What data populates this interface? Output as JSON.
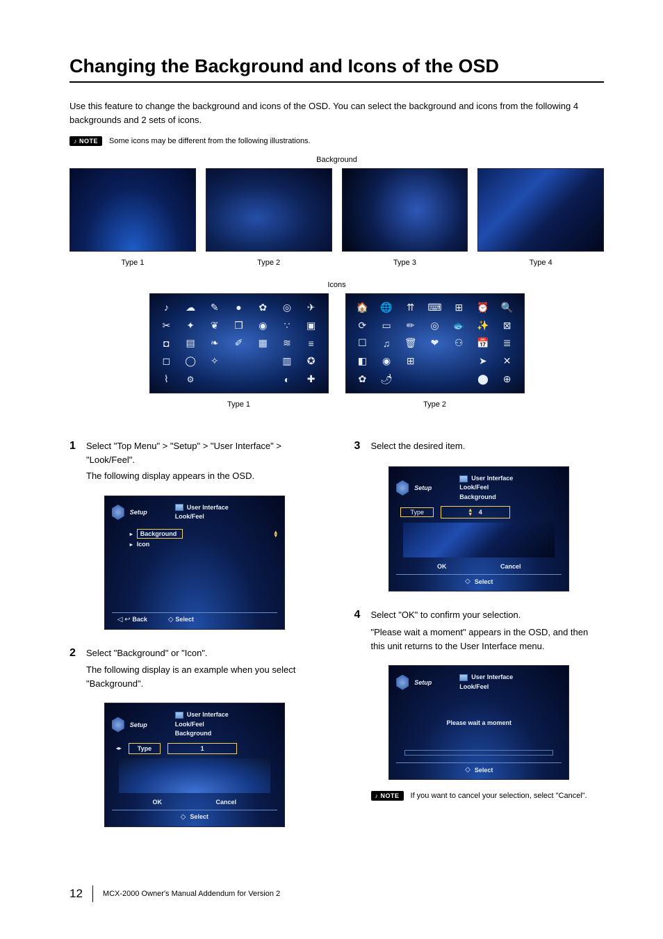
{
  "title": "Changing the Background and Icons of the OSD",
  "intro": "Use this feature to change the background and icons of the OSD. You can select the background and icons from the following 4 backgrounds and 2 sets of icons.",
  "note1": {
    "label": "NOTE",
    "text": "Some icons may be different from the following illustrations."
  },
  "labels": {
    "background": "Background",
    "icons": "Icons",
    "type1": "Type 1",
    "type2": "Type 2",
    "type3": "Type 3",
    "type4": "Type 4"
  },
  "steps": {
    "s1": {
      "num": "1",
      "text": "Select \"Top Menu\" > \"Setup\" > \"User Interface\" > \"Look/Feel\".",
      "sub": "The following display appears in the OSD."
    },
    "s2": {
      "num": "2",
      "text": "Select \"Background\" or \"Icon\".",
      "sub": "The following display is an example when you select \"Background\"."
    },
    "s3": {
      "num": "3",
      "text": "Select the desired item."
    },
    "s4": {
      "num": "4",
      "text": "Select \"OK\" to confirm your selection.",
      "sub": "\"Please wait a moment\" appears in the OSD, and then this unit returns to the User Interface menu."
    }
  },
  "osd": {
    "setup": "Setup",
    "ui": "User Interface",
    "lookfeel": "Look/Feel",
    "background": "Background",
    "icon": "Icon",
    "back": "Back",
    "select": "Select",
    "type": "Type",
    "ok": "OK",
    "cancel": "Cancel",
    "value1": "1",
    "value4": "4",
    "wait": "Please wait a moment"
  },
  "note2": {
    "label": "NOTE",
    "text": "If you want to cancel your selection, select \"Cancel\"."
  },
  "footer": {
    "page": "12",
    "text": "MCX-2000 Owner's Manual Addendum for Version 2"
  }
}
